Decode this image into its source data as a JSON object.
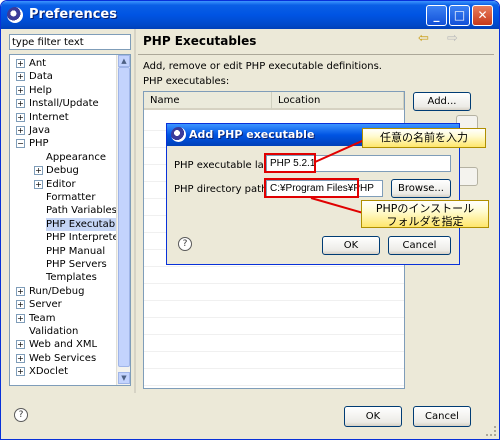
{
  "window": {
    "title": "Preferences",
    "min": "_",
    "max": "□",
    "close": "✕"
  },
  "filter": {
    "value": "type filter text"
  },
  "tree": [
    {
      "label": "Ant",
      "level": 0,
      "exp": "+"
    },
    {
      "label": "Data",
      "level": 0,
      "exp": "+"
    },
    {
      "label": "Help",
      "level": 0,
      "exp": "+"
    },
    {
      "label": "Install/Update",
      "level": 0,
      "exp": "+"
    },
    {
      "label": "Internet",
      "level": 0,
      "exp": "+"
    },
    {
      "label": "Java",
      "level": 0,
      "exp": "+"
    },
    {
      "label": "PHP",
      "level": 0,
      "exp": "−"
    },
    {
      "label": "Appearance",
      "level": 1,
      "exp": ""
    },
    {
      "label": "Debug",
      "level": 1,
      "exp": "+"
    },
    {
      "label": "Editor",
      "level": 1,
      "exp": "+"
    },
    {
      "label": "Formatter",
      "level": 1,
      "exp": ""
    },
    {
      "label": "Path Variables",
      "level": 1,
      "exp": ""
    },
    {
      "label": "PHP Executables",
      "level": 1,
      "exp": "",
      "selected": true
    },
    {
      "label": "PHP Interpreter",
      "level": 1,
      "exp": ""
    },
    {
      "label": "PHP Manual",
      "level": 1,
      "exp": ""
    },
    {
      "label": "PHP Servers",
      "level": 1,
      "exp": ""
    },
    {
      "label": "Templates",
      "level": 1,
      "exp": ""
    },
    {
      "label": "Run/Debug",
      "level": 0,
      "exp": "+"
    },
    {
      "label": "Server",
      "level": 0,
      "exp": "+"
    },
    {
      "label": "Team",
      "level": 0,
      "exp": "+"
    },
    {
      "label": "Validation",
      "level": 0,
      "exp": ""
    },
    {
      "label": "Web and XML",
      "level": 0,
      "exp": "+"
    },
    {
      "label": "Web Services",
      "level": 0,
      "exp": "+"
    },
    {
      "label": "XDoclet",
      "level": 0,
      "exp": "+"
    }
  ],
  "page": {
    "title": "PHP Executables",
    "back": "⇦",
    "forward": "⇨",
    "description": "Add, remove or edit PHP executable definitions.",
    "list_label": "PHP executables:",
    "columns": [
      "Name",
      "Location"
    ],
    "add_button": "Add..."
  },
  "footer": {
    "help": "?",
    "ok": "OK",
    "cancel": "Cancel"
  },
  "dialog": {
    "title": "Add PHP executable",
    "label_name": "PHP executable label:",
    "value_name": "PHP 5.2.1",
    "label_path": "PHP directory path:",
    "value_path": "C:¥Program Files¥PHP",
    "browse": "Browse...",
    "help": "?",
    "ok": "OK",
    "cancel": "Cancel"
  },
  "callouts": {
    "name_hint": "任意の名前を入力",
    "path_hint_1": "PHPのインストール",
    "path_hint_2": "フォルダを指定"
  },
  "colors": {
    "title_blue": "#0054e3",
    "highlight_red": "#e00000",
    "callout_yellow": "#ffe66b"
  }
}
